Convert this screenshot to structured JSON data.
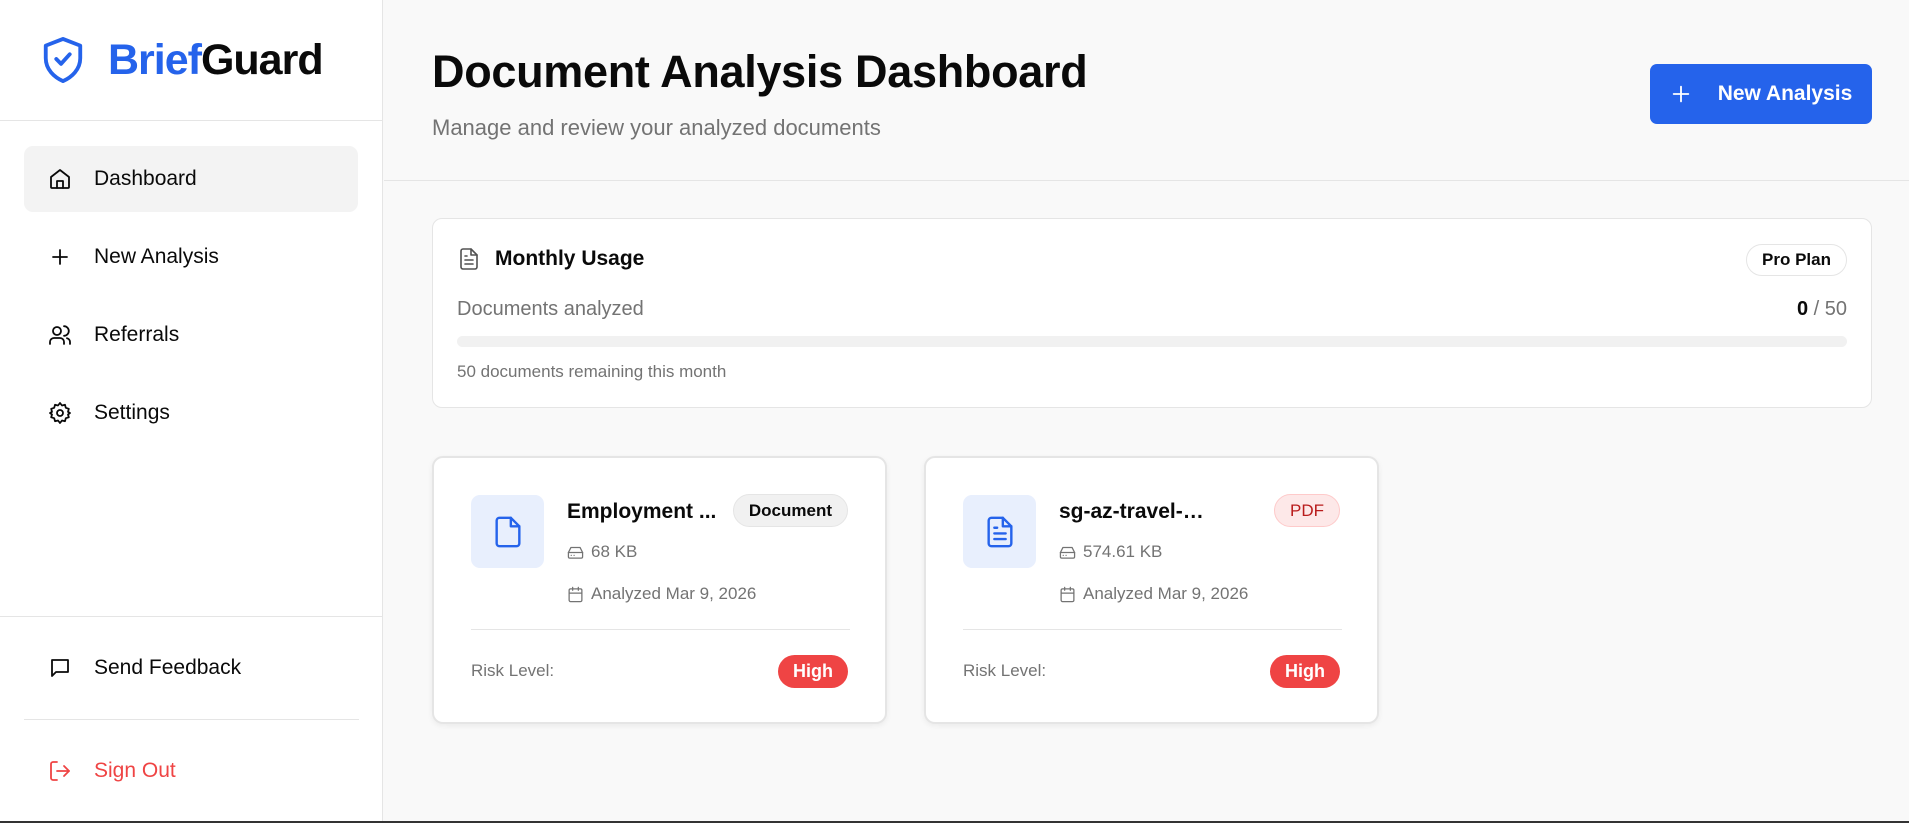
{
  "brand": {
    "name_part1": "Brief",
    "name_part2": "Guard",
    "color": "#2563eb"
  },
  "sidebar": {
    "items": [
      {
        "label": "Dashboard",
        "icon": "home-icon",
        "active": true
      },
      {
        "label": "New Analysis",
        "icon": "plus-icon"
      },
      {
        "label": "Referrals",
        "icon": "users-icon"
      },
      {
        "label": "Settings",
        "icon": "gear-icon"
      }
    ],
    "feedback_label": "Send Feedback",
    "signout_label": "Sign Out"
  },
  "header": {
    "title": "Document Analysis Dashboard",
    "subtitle": "Manage and review your analyzed documents",
    "new_analysis_label": "New Analysis"
  },
  "usage": {
    "title": "Monthly Usage",
    "plan": "Pro Plan",
    "label": "Documents analyzed",
    "used": "0",
    "separator": " / ",
    "limit": "50",
    "progress_fraction": 0,
    "remaining_note": "50 documents remaining this month"
  },
  "documents": [
    {
      "name": "Employment ...",
      "type": "Document",
      "size": "68 KB",
      "analyzed": "Analyzed Mar 9, 2026",
      "risk_label": "Risk Level:",
      "risk": "High"
    },
    {
      "name": "sg-az-travel-protec...",
      "type": "PDF",
      "size": "574.61 KB",
      "analyzed": "Analyzed Mar 9, 2026",
      "risk_label": "Risk Level:",
      "risk": "High"
    }
  ],
  "colors": {
    "accent": "#2563eb",
    "danger": "#ef4444",
    "muted": "#737373"
  }
}
